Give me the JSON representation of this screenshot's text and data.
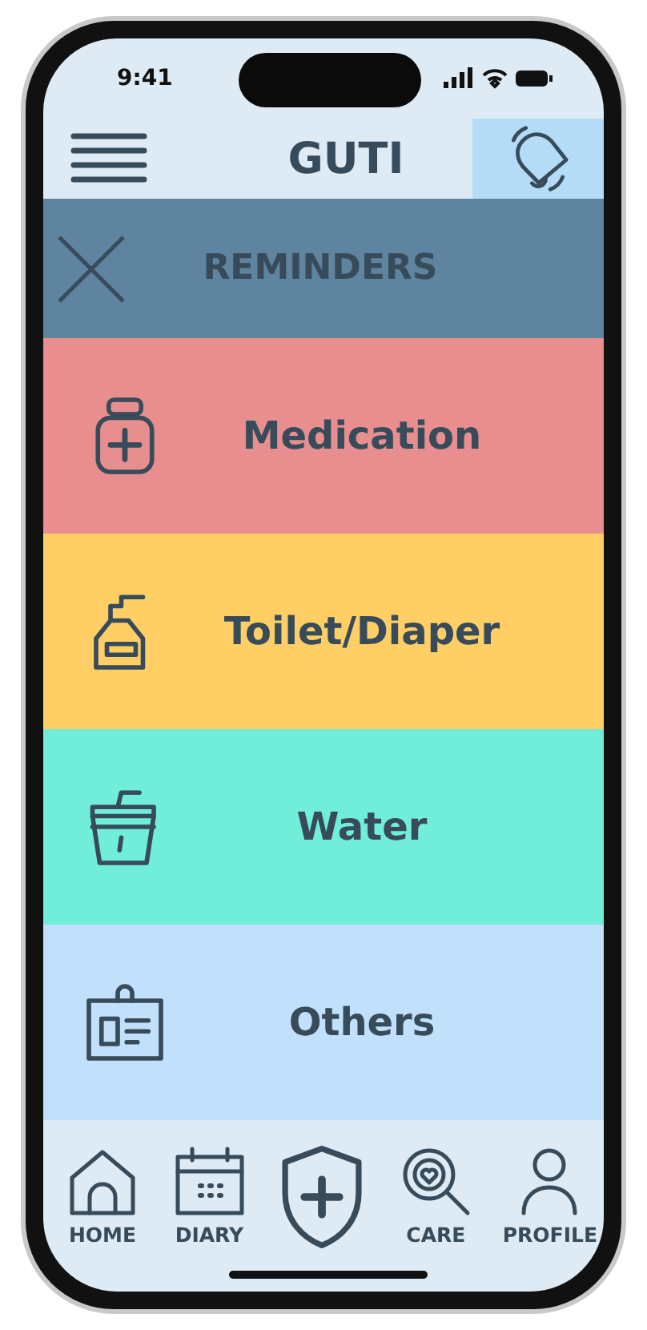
{
  "status_bar": {
    "time": "9:41"
  },
  "header": {
    "title": "GUTI",
    "bell_active": true
  },
  "panel": {
    "title": "REMINDERS"
  },
  "reminders": [
    {
      "label": "Medication",
      "kind": "medicine",
      "color": "#e88e8e"
    },
    {
      "label": "Toilet/Diaper",
      "kind": "soap",
      "color": "#ffcf66"
    },
    {
      "label": "Water",
      "kind": "drink",
      "color": "#70eed9"
    },
    {
      "label": "Others",
      "kind": "badge",
      "color": "#c0e0fb"
    }
  ],
  "nav": [
    {
      "kind": "home",
      "label": "HOME"
    },
    {
      "kind": "diary",
      "label": "DIARY"
    },
    {
      "kind": "shield"
    },
    {
      "kind": "care",
      "label": "CARE"
    },
    {
      "kind": "profile",
      "label": "PROFILE"
    }
  ]
}
